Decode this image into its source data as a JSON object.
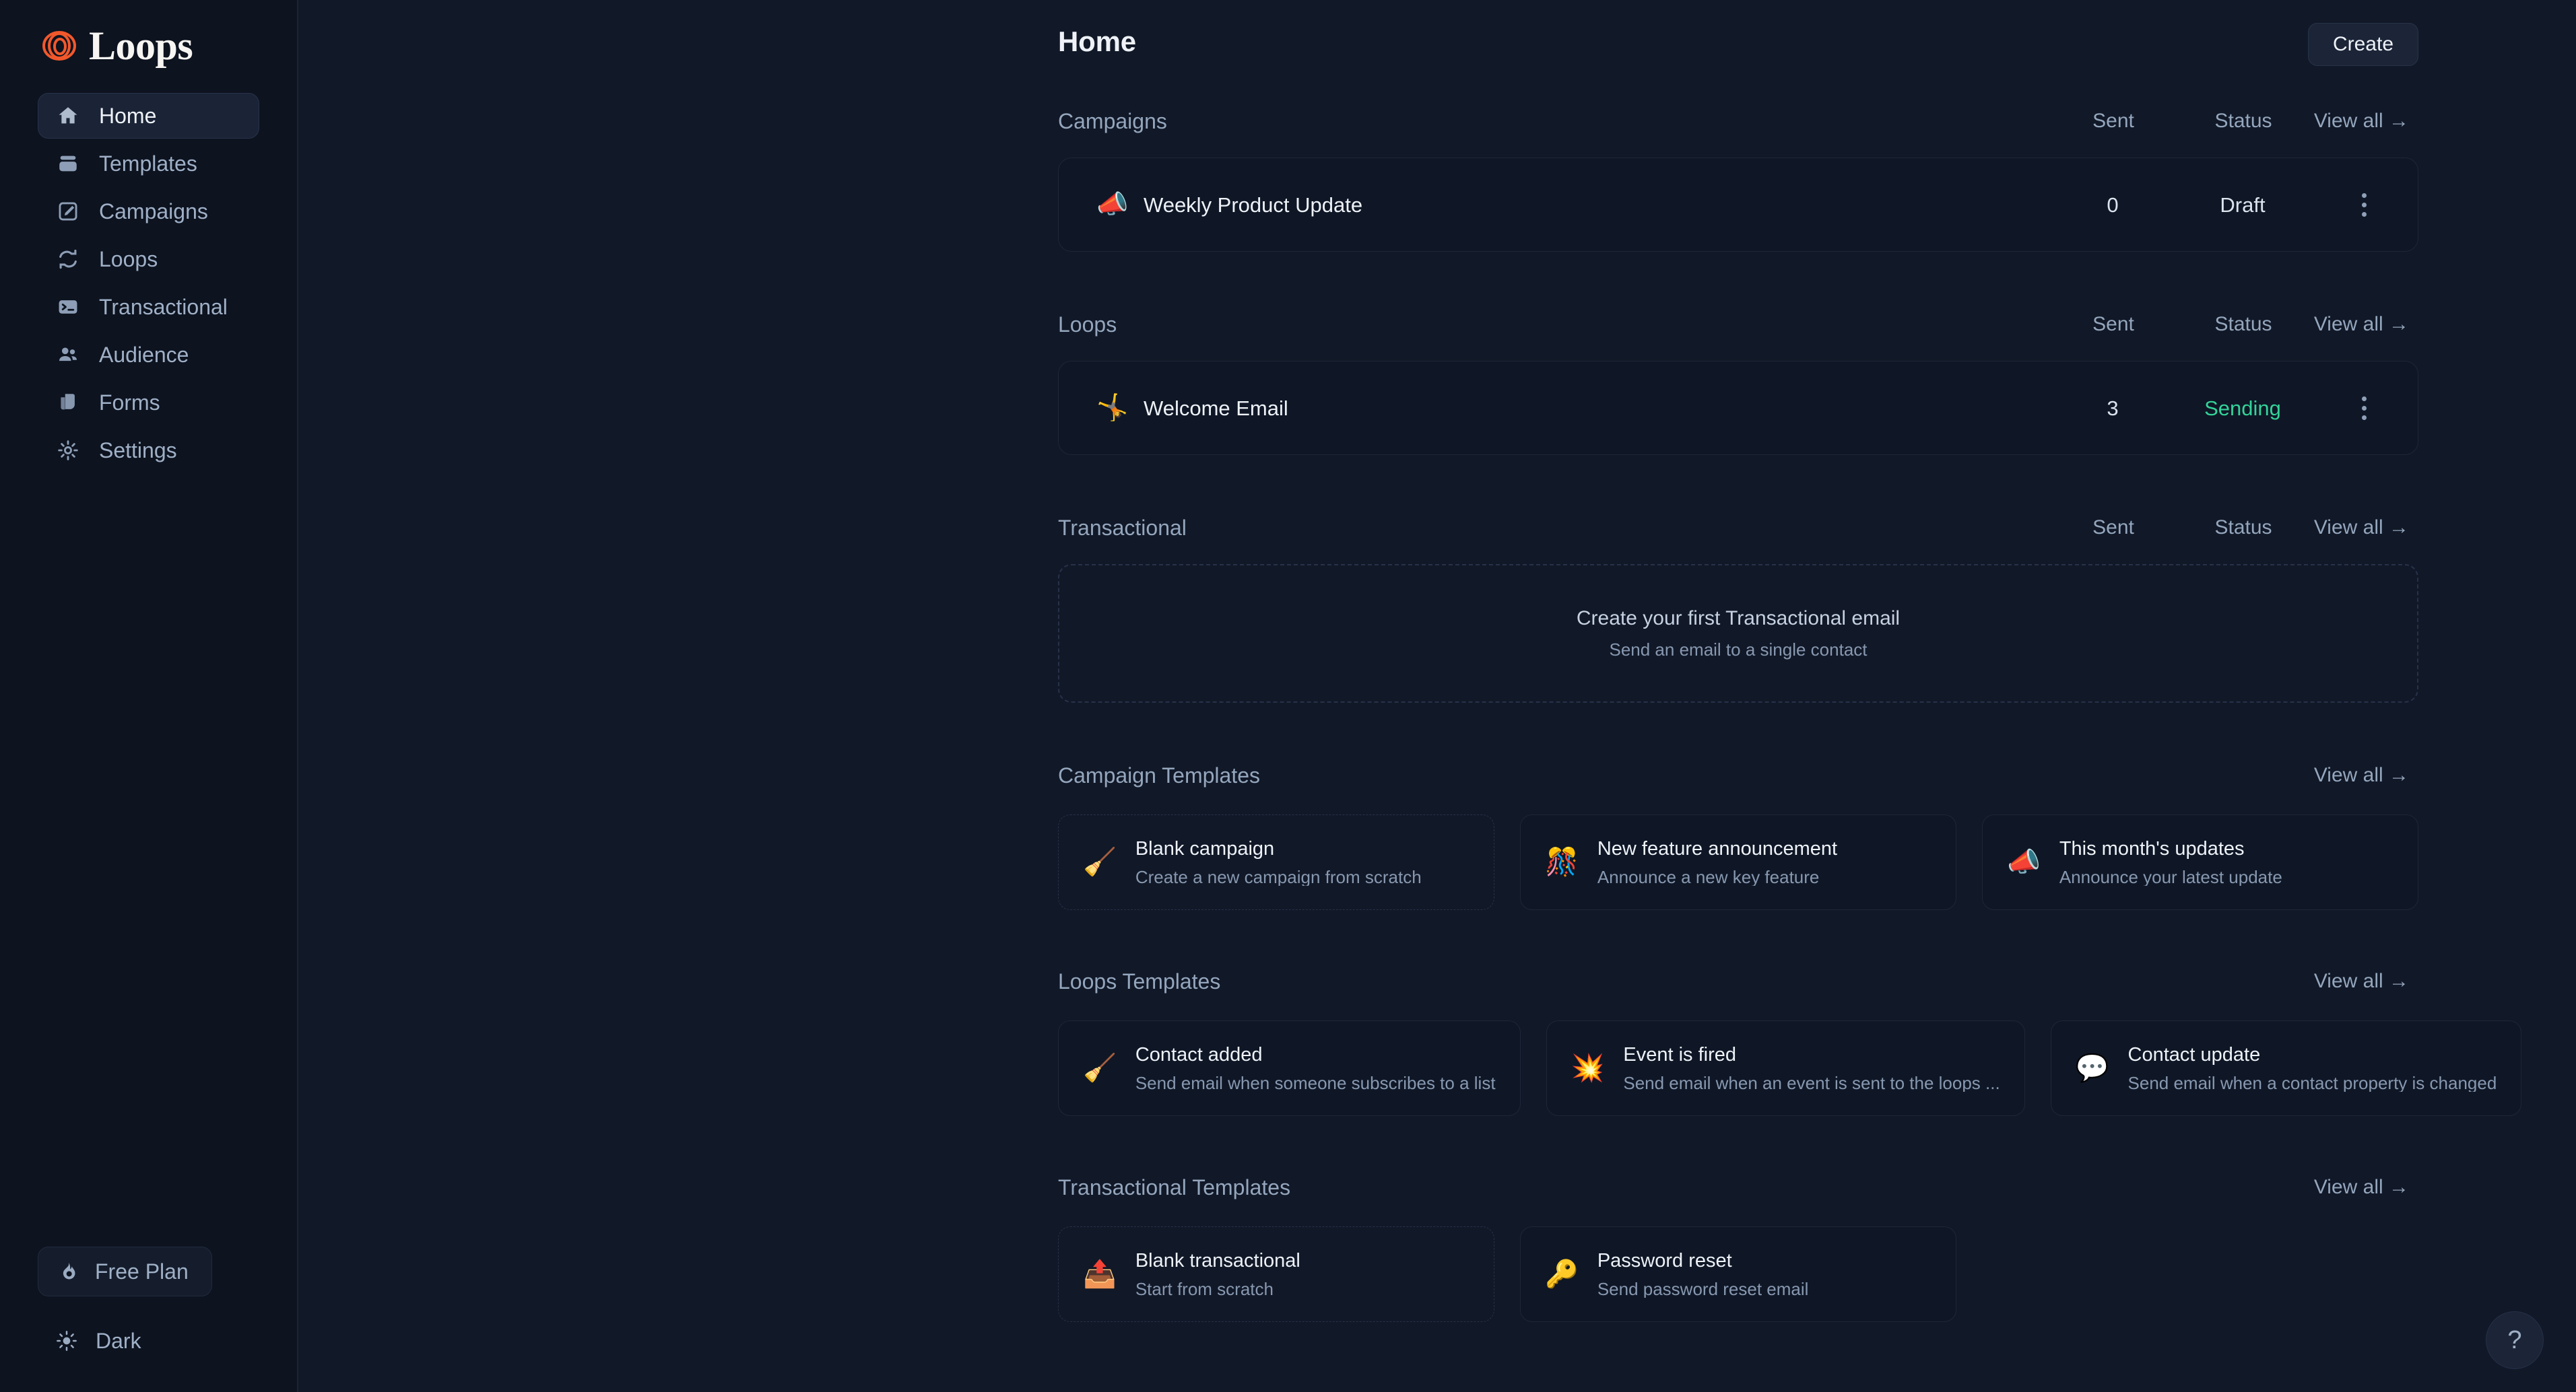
{
  "brand": {
    "name": "Loops",
    "logo_icon": "loops-spiral-icon",
    "accent_color": "#f1582c"
  },
  "sidebar": {
    "items": [
      {
        "label": "Home",
        "icon": "home-icon",
        "active": true
      },
      {
        "label": "Templates",
        "icon": "templates-icon",
        "active": false
      },
      {
        "label": "Campaigns",
        "icon": "edit-square-icon",
        "active": false
      },
      {
        "label": "Loops",
        "icon": "refresh-loop-icon",
        "active": false
      },
      {
        "label": "Transactional",
        "icon": "terminal-icon",
        "active": false
      },
      {
        "label": "Audience",
        "icon": "people-icon",
        "active": false
      },
      {
        "label": "Forms",
        "icon": "forms-stack-icon",
        "active": false
      },
      {
        "label": "Settings",
        "icon": "gear-icon",
        "active": false
      }
    ],
    "plan": {
      "label": "Free Plan",
      "icon": "flame-icon"
    },
    "theme": {
      "label": "Dark",
      "icon": "sun-icon"
    }
  },
  "header": {
    "title": "Home",
    "create_label": "Create"
  },
  "columns": {
    "sent": "Sent",
    "status": "Status",
    "view_all": "View all →"
  },
  "sections": {
    "campaigns": {
      "title": "Campaigns",
      "rows": [
        {
          "emoji": "📣",
          "icon": "megaphone-icon",
          "name": "Weekly Product Update",
          "sent": "0",
          "status": "Draft",
          "status_state": "draft"
        }
      ]
    },
    "loops": {
      "title": "Loops",
      "rows": [
        {
          "emoji": "🤸",
          "icon": "cartwheel-person-icon",
          "name": "Welcome Email",
          "sent": "3",
          "status": "Sending",
          "status_state": "sending"
        }
      ]
    },
    "transactional": {
      "title": "Transactional",
      "empty_title": "Create your first Transactional email",
      "empty_sub": "Send an email to a single contact"
    },
    "campaign_templates": {
      "title": "Campaign Templates",
      "cards": [
        {
          "emoji": "🧹",
          "icon": "broom-icon",
          "title": "Blank campaign",
          "desc": "Create a new campaign from scratch",
          "dashed": true
        },
        {
          "emoji": "🎊",
          "icon": "confetti-ball-icon",
          "title": "New feature announcement",
          "desc": "Announce a new key feature",
          "dashed": false
        },
        {
          "emoji": "📣",
          "icon": "megaphone-icon",
          "title": "This month's updates",
          "desc": "Announce your latest update",
          "dashed": false
        }
      ]
    },
    "loops_templates": {
      "title": "Loops Templates",
      "cards": [
        {
          "emoji": "🧹",
          "icon": "broom-icon",
          "title": "Contact added",
          "desc": "Send email when someone subscribes to a list",
          "dashed": false
        },
        {
          "emoji": "💥",
          "icon": "collision-icon",
          "title": "Event is fired",
          "desc": "Send email when an event is sent to the loops ...",
          "dashed": false
        },
        {
          "emoji": "💬",
          "icon": "speech-balloon-icon",
          "title": "Contact update",
          "desc": "Send email when a contact property is changed",
          "dashed": false
        }
      ]
    },
    "transactional_templates": {
      "title": "Transactional Templates",
      "cards": [
        {
          "emoji": "📤",
          "icon": "outbox-tray-icon",
          "title": "Blank transactional",
          "desc": "Start from scratch",
          "dashed": true
        },
        {
          "emoji": "🔑",
          "icon": "key-icon",
          "title": "Password reset",
          "desc": "Send password reset email",
          "dashed": false
        }
      ]
    }
  },
  "help": {
    "label": "?",
    "icon": "question-mark-icon"
  }
}
